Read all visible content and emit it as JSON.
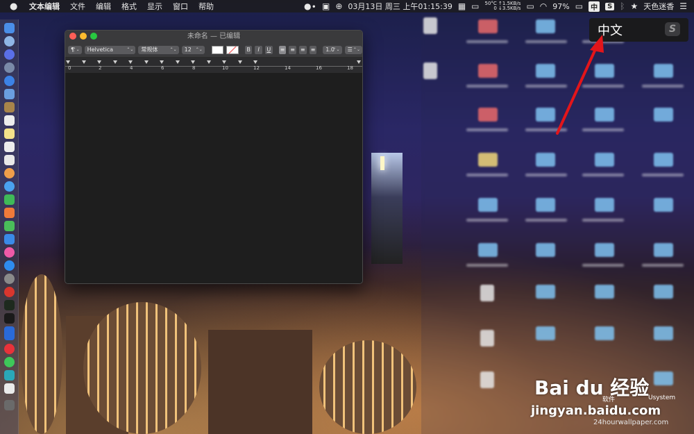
{
  "menubar": {
    "app_name": "文本编辑",
    "menus": [
      "文件",
      "编辑",
      "格式",
      "显示",
      "窗口",
      "帮助"
    ],
    "datetime": "03月13日 周三 上午01:15:39",
    "net_up": "↑1.5KB/s",
    "net_down": "↓3.5KB/s",
    "temp": "50°C",
    "temp_sub": "0",
    "battery": "97%",
    "input_method": "中",
    "user_name": "天色迷香"
  },
  "window": {
    "title": "未命名 — 已编辑",
    "toolbar": {
      "paragraph_style": "¶",
      "font_family": "Helvetica",
      "font_style": "常规体",
      "font_size": "12",
      "bold": "B",
      "italic": "I",
      "underline": "U",
      "line_spacing": "1.0",
      "list_style": "☰"
    },
    "ruler_numbers": [
      "0",
      "2",
      "4",
      "6",
      "8",
      "10",
      "12",
      "14",
      "16",
      "18"
    ]
  },
  "lang_tooltip": {
    "text": "中文",
    "icon_letter": "S"
  },
  "desktop": {
    "software_label": "软件",
    "usystem_label": "Usystem"
  },
  "watermark": {
    "baidu": "Bai du 经验",
    "url": "jingyan.baidu.com",
    "wallpaper": "24hourwallpaper.com"
  },
  "colors": {
    "close": "#ff5f57",
    "minimize": "#febc2e",
    "zoom": "#28c840",
    "arrow": "#e3151a"
  }
}
